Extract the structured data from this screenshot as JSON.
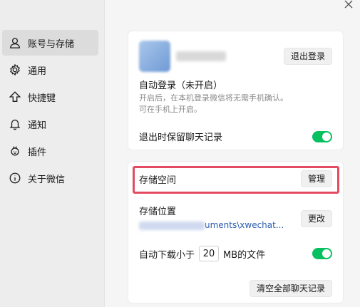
{
  "sidebar": {
    "items": [
      {
        "label": "账号与存储",
        "icon": "user-icon",
        "active": true
      },
      {
        "label": "通用",
        "icon": "gear-icon",
        "active": false
      },
      {
        "label": "快捷键",
        "icon": "arrow-up-icon",
        "active": false
      },
      {
        "label": "通知",
        "icon": "bell-icon",
        "active": false
      },
      {
        "label": "插件",
        "icon": "plugin-icon",
        "active": false
      },
      {
        "label": "关于微信",
        "icon": "info-icon",
        "active": false
      }
    ]
  },
  "account": {
    "logout_label": "退出登录",
    "auto_login_title": "自动登录（未开启）",
    "auto_login_desc_1": "开启后，在本机登录微信将无需手机确认。",
    "auto_login_desc_2": "可在手机上开启。",
    "keep_history_label": "退出时保留聊天记录",
    "keep_history_on": true
  },
  "storage": {
    "space_label": "存储空间",
    "manage_label": "管理",
    "location_label": "存储位置",
    "location_path": "uments\\xwechat...",
    "change_label": "更改",
    "auto_download_prefix": "自动下载小于",
    "auto_download_value": "20",
    "auto_download_suffix": "MB的文件",
    "auto_download_on": true,
    "clear_label": "清空全部聊天记录"
  },
  "colors": {
    "toggle_on": "#07c160",
    "highlight": "#e44b60"
  }
}
